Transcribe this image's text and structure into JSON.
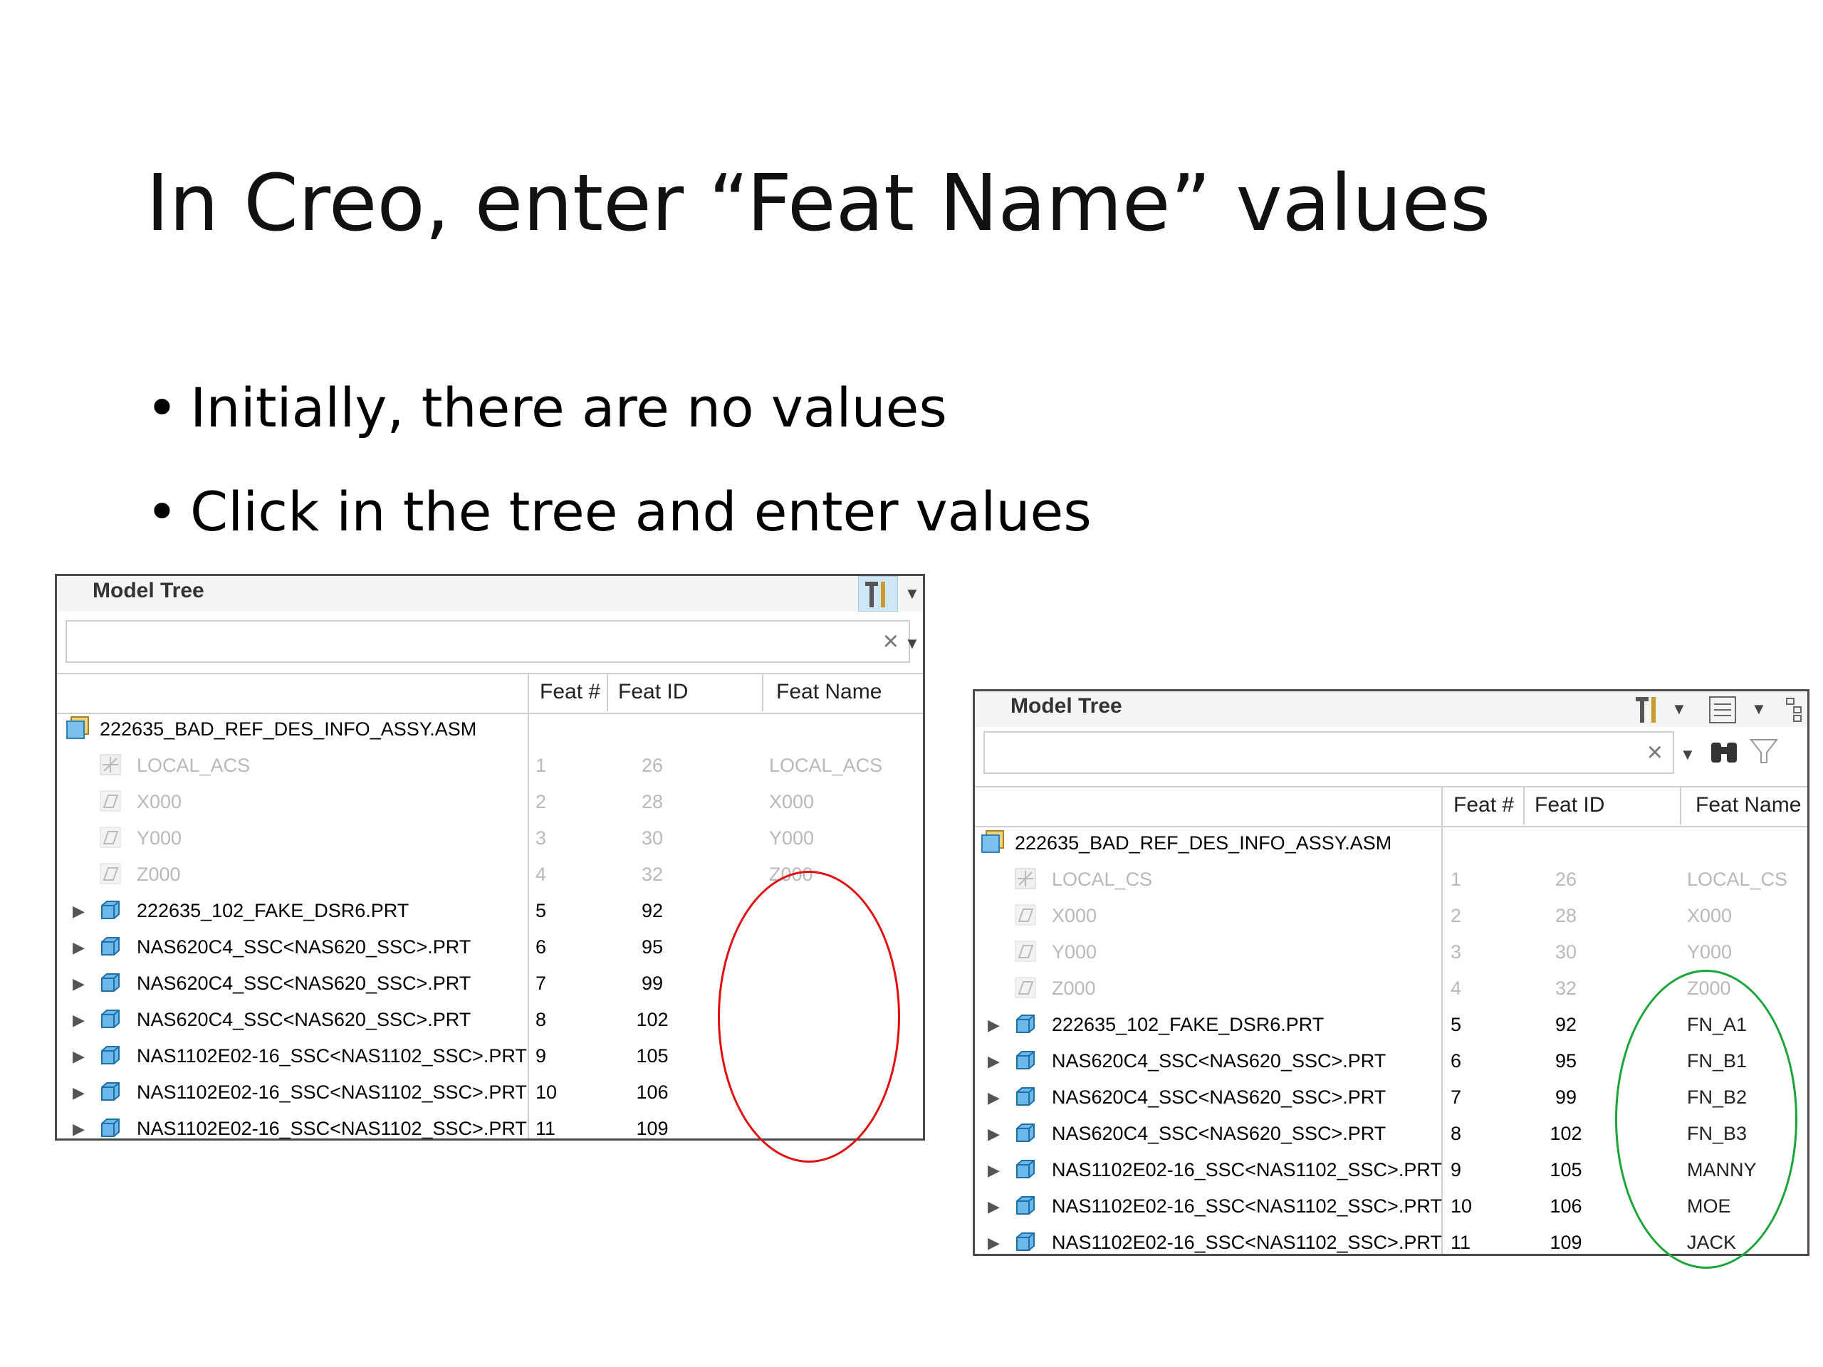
{
  "slide": {
    "title": "In Creo, enter “Feat Name” values",
    "bullets": [
      "Initially, there are no values",
      "Click in the tree and enter values"
    ]
  },
  "colors": {
    "red_circle": "#e01010",
    "green_circle": "#1aa53a"
  },
  "tree_before": {
    "title": "Model Tree",
    "search_value": "",
    "columns": [
      "Feat #",
      "Feat ID",
      "Feat Name"
    ],
    "root": "222635_BAD_REF_DES_INFO_ASSY.ASM",
    "rows": [
      {
        "name": "LOCAL_ACS",
        "feat_no": "1",
        "feat_id": "26",
        "feat_name": "LOCAL_ACS",
        "icon": "csys-icon"
      },
      {
        "name": "X000",
        "feat_no": "2",
        "feat_id": "28",
        "feat_name": "X000",
        "icon": "datum-plane-icon"
      },
      {
        "name": "Y000",
        "feat_no": "3",
        "feat_id": "30",
        "feat_name": "Y000",
        "icon": "datum-plane-icon"
      },
      {
        "name": "Z000",
        "feat_no": "4",
        "feat_id": "32",
        "feat_name": "Z000",
        "icon": "datum-plane-icon"
      },
      {
        "name": "222635_102_FAKE_DSR6.PRT",
        "feat_no": "5",
        "feat_id": "92",
        "feat_name": "",
        "icon": "part-icon"
      },
      {
        "name": "NAS620C4_SSC<NAS620_SSC>.PRT",
        "feat_no": "6",
        "feat_id": "95",
        "feat_name": "",
        "icon": "part-icon"
      },
      {
        "name": "NAS620C4_SSC<NAS620_SSC>.PRT",
        "feat_no": "7",
        "feat_id": "99",
        "feat_name": "",
        "icon": "part-icon"
      },
      {
        "name": "NAS620C4_SSC<NAS620_SSC>.PRT",
        "feat_no": "8",
        "feat_id": "102",
        "feat_name": "",
        "icon": "part-icon"
      },
      {
        "name": "NAS1102E02-16_SSC<NAS1102_SSC>.PRT",
        "feat_no": "9",
        "feat_id": "105",
        "feat_name": "",
        "icon": "part-icon"
      },
      {
        "name": "NAS1102E02-16_SSC<NAS1102_SSC>.PRT",
        "feat_no": "10",
        "feat_id": "106",
        "feat_name": "",
        "icon": "part-icon"
      },
      {
        "name": "NAS1102E02-16_SSC<NAS1102_SSC>.PRT",
        "feat_no": "11",
        "feat_id": "109",
        "feat_name": "",
        "icon": "part-icon"
      }
    ]
  },
  "tree_after": {
    "title": "Model Tree",
    "search_value": "",
    "columns": [
      "Feat #",
      "Feat ID",
      "Feat Name"
    ],
    "root": "222635_BAD_REF_DES_INFO_ASSY.ASM",
    "rows": [
      {
        "name": "LOCAL_CS",
        "feat_no": "1",
        "feat_id": "26",
        "feat_name": "LOCAL_CS",
        "icon": "csys-icon"
      },
      {
        "name": "X000",
        "feat_no": "2",
        "feat_id": "28",
        "feat_name": "X000",
        "icon": "datum-plane-icon"
      },
      {
        "name": "Y000",
        "feat_no": "3",
        "feat_id": "30",
        "feat_name": "Y000",
        "icon": "datum-plane-icon"
      },
      {
        "name": "Z000",
        "feat_no": "4",
        "feat_id": "32",
        "feat_name": "Z000",
        "icon": "datum-plane-icon"
      },
      {
        "name": "222635_102_FAKE_DSR6.PRT",
        "feat_no": "5",
        "feat_id": "92",
        "feat_name": "FN_A1",
        "icon": "part-icon"
      },
      {
        "name": "NAS620C4_SSC<NAS620_SSC>.PRT",
        "feat_no": "6",
        "feat_id": "95",
        "feat_name": "FN_B1",
        "icon": "part-icon"
      },
      {
        "name": "NAS620C4_SSC<NAS620_SSC>.PRT",
        "feat_no": "7",
        "feat_id": "99",
        "feat_name": "FN_B2",
        "icon": "part-icon"
      },
      {
        "name": "NAS620C4_SSC<NAS620_SSC>.PRT",
        "feat_no": "8",
        "feat_id": "102",
        "feat_name": "FN_B3",
        "icon": "part-icon"
      },
      {
        "name": "NAS1102E02-16_SSC<NAS1102_SSC>.PRT",
        "feat_no": "9",
        "feat_id": "105",
        "feat_name": "MANNY",
        "icon": "part-icon"
      },
      {
        "name": "NAS1102E02-16_SSC<NAS1102_SSC>.PRT",
        "feat_no": "10",
        "feat_id": "106",
        "feat_name": "MOE",
        "icon": "part-icon"
      },
      {
        "name": "NAS1102E02-16_SSC<NAS1102_SSC>.PRT",
        "feat_no": "11",
        "feat_id": "109",
        "feat_name": "JACK",
        "icon": "part-icon"
      }
    ]
  }
}
